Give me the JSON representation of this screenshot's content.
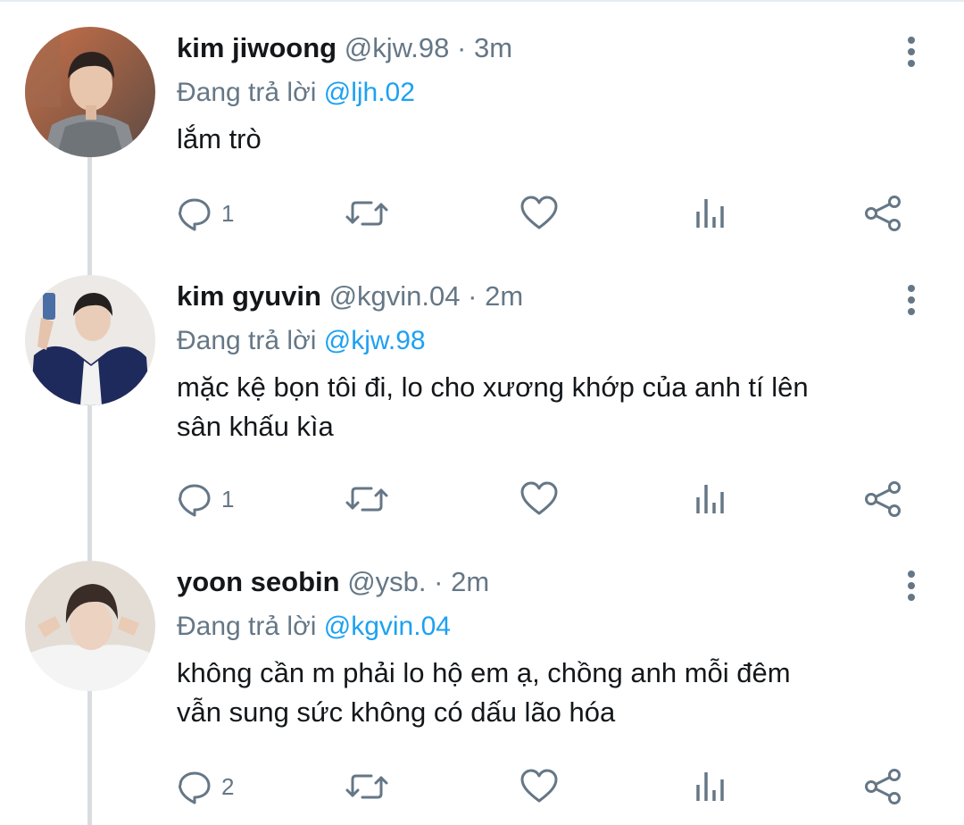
{
  "tweets": [
    {
      "name": "kim jiwoong",
      "handle": "@kjw.98",
      "separator": "·",
      "time": "3m",
      "reply_prefix": "Đang trả lời",
      "reply_to": "@ljh.02",
      "lines": [
        "lắm trò"
      ],
      "reply_count": "1",
      "avatar_icon": "profile-photo"
    },
    {
      "name": "kim gyuvin",
      "handle": "@kgvin.04",
      "separator": "·",
      "time": "2m",
      "reply_prefix": "Đang trả lời",
      "reply_to": "@kjw.98",
      "lines": [
        "mặc kệ bọn tôi đi, lo cho xương khớp của anh tí lên",
        "sân khấu kìa"
      ],
      "reply_count": "1",
      "avatar_icon": "profile-photo"
    },
    {
      "name": "yoon seobin",
      "handle": "@ysb.",
      "separator": "·",
      "time": "2m",
      "reply_prefix": "Đang trả lời",
      "reply_to": "@kgvin.04",
      "lines": [
        "không cần m phải lo hộ em ạ, chồng anh mỗi đêm",
        "vẫn sung sức không có dấu lão hóa"
      ],
      "reply_count": "2",
      "avatar_icon": "profile-photo"
    }
  ],
  "icons": {
    "reply": "reply-icon",
    "retweet": "retweet-icon",
    "like": "heart-icon",
    "analytics": "analytics-icon",
    "share": "share-icon",
    "more": "more-vertical-icon"
  },
  "colors": {
    "link": "#1da1f2",
    "secondary_text": "#657786",
    "icon": "#657786",
    "thread_line": "#d9dde0"
  }
}
